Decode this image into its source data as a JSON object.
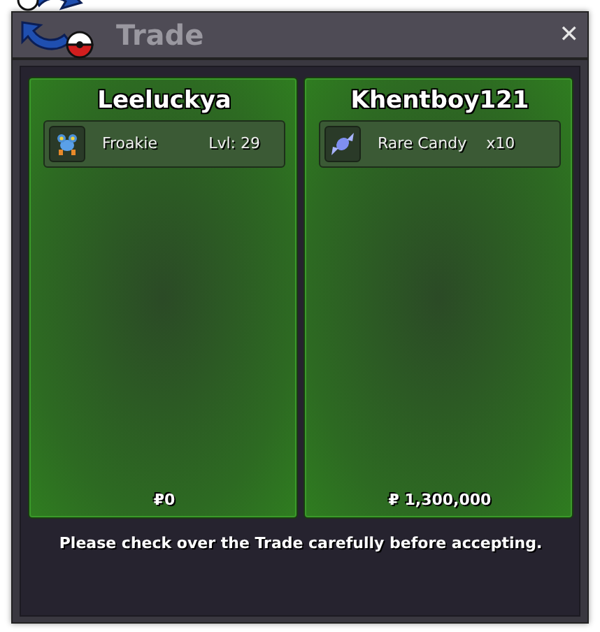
{
  "window": {
    "title": "Trade",
    "close": "✕"
  },
  "panels": [
    {
      "player": "Leeluckya",
      "offers": [
        {
          "kind": "pokemon",
          "name": "Froakie",
          "detail": "Lvl: 29"
        }
      ],
      "money": "₽0"
    },
    {
      "player": "Khentboy121",
      "offers": [
        {
          "kind": "item",
          "name": "Rare Candy",
          "detail": "x10"
        }
      ],
      "money": "₽ 1,300,000"
    }
  ],
  "notice": "Please check over the Trade carefully before accepting."
}
